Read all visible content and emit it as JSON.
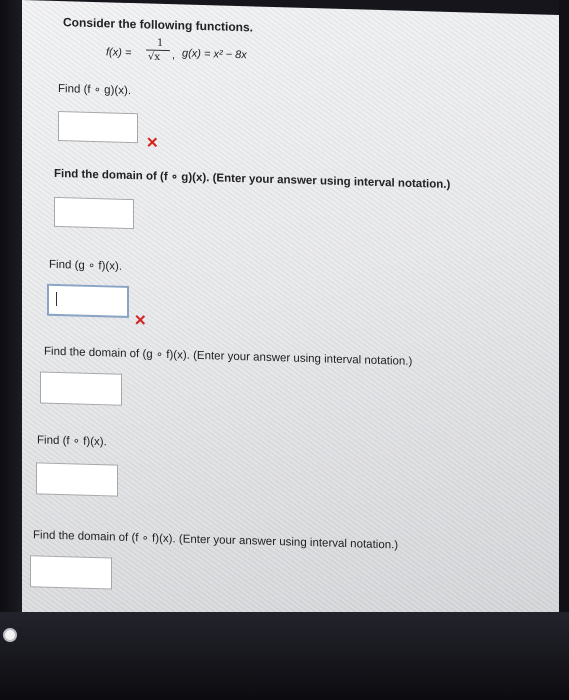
{
  "intro": "Consider the following functions.",
  "functions": {
    "f_lhs": "f(x) =",
    "f_num": "1",
    "f_den": "√x",
    "f_comma": ",",
    "g_def": "g(x) = x² − 8x"
  },
  "q1": {
    "prompt": "Find  (f ∘ g)(x).",
    "answer": "",
    "status": "✕"
  },
  "q2": {
    "prompt": "Find the domain of  (f ∘ g)(x).  (Enter your answer using interval notation.)",
    "answer": ""
  },
  "q3": {
    "prompt": "Find  (g ∘ f)(x).",
    "answer": "",
    "status": "✕"
  },
  "q4": {
    "prompt": "Find the domain of  (g ∘ f)(x).  (Enter your answer using interval notation.)",
    "answer": ""
  },
  "q5": {
    "prompt": "Find  (f ∘ f)(x).",
    "answer": ""
  },
  "q6": {
    "prompt": "Find the domain of  (f ∘ f)(x).  (Enter your answer using interval notation.)",
    "answer": ""
  },
  "colors": {
    "wrong": "#d5231f",
    "active_border": "#8aa4c4"
  }
}
